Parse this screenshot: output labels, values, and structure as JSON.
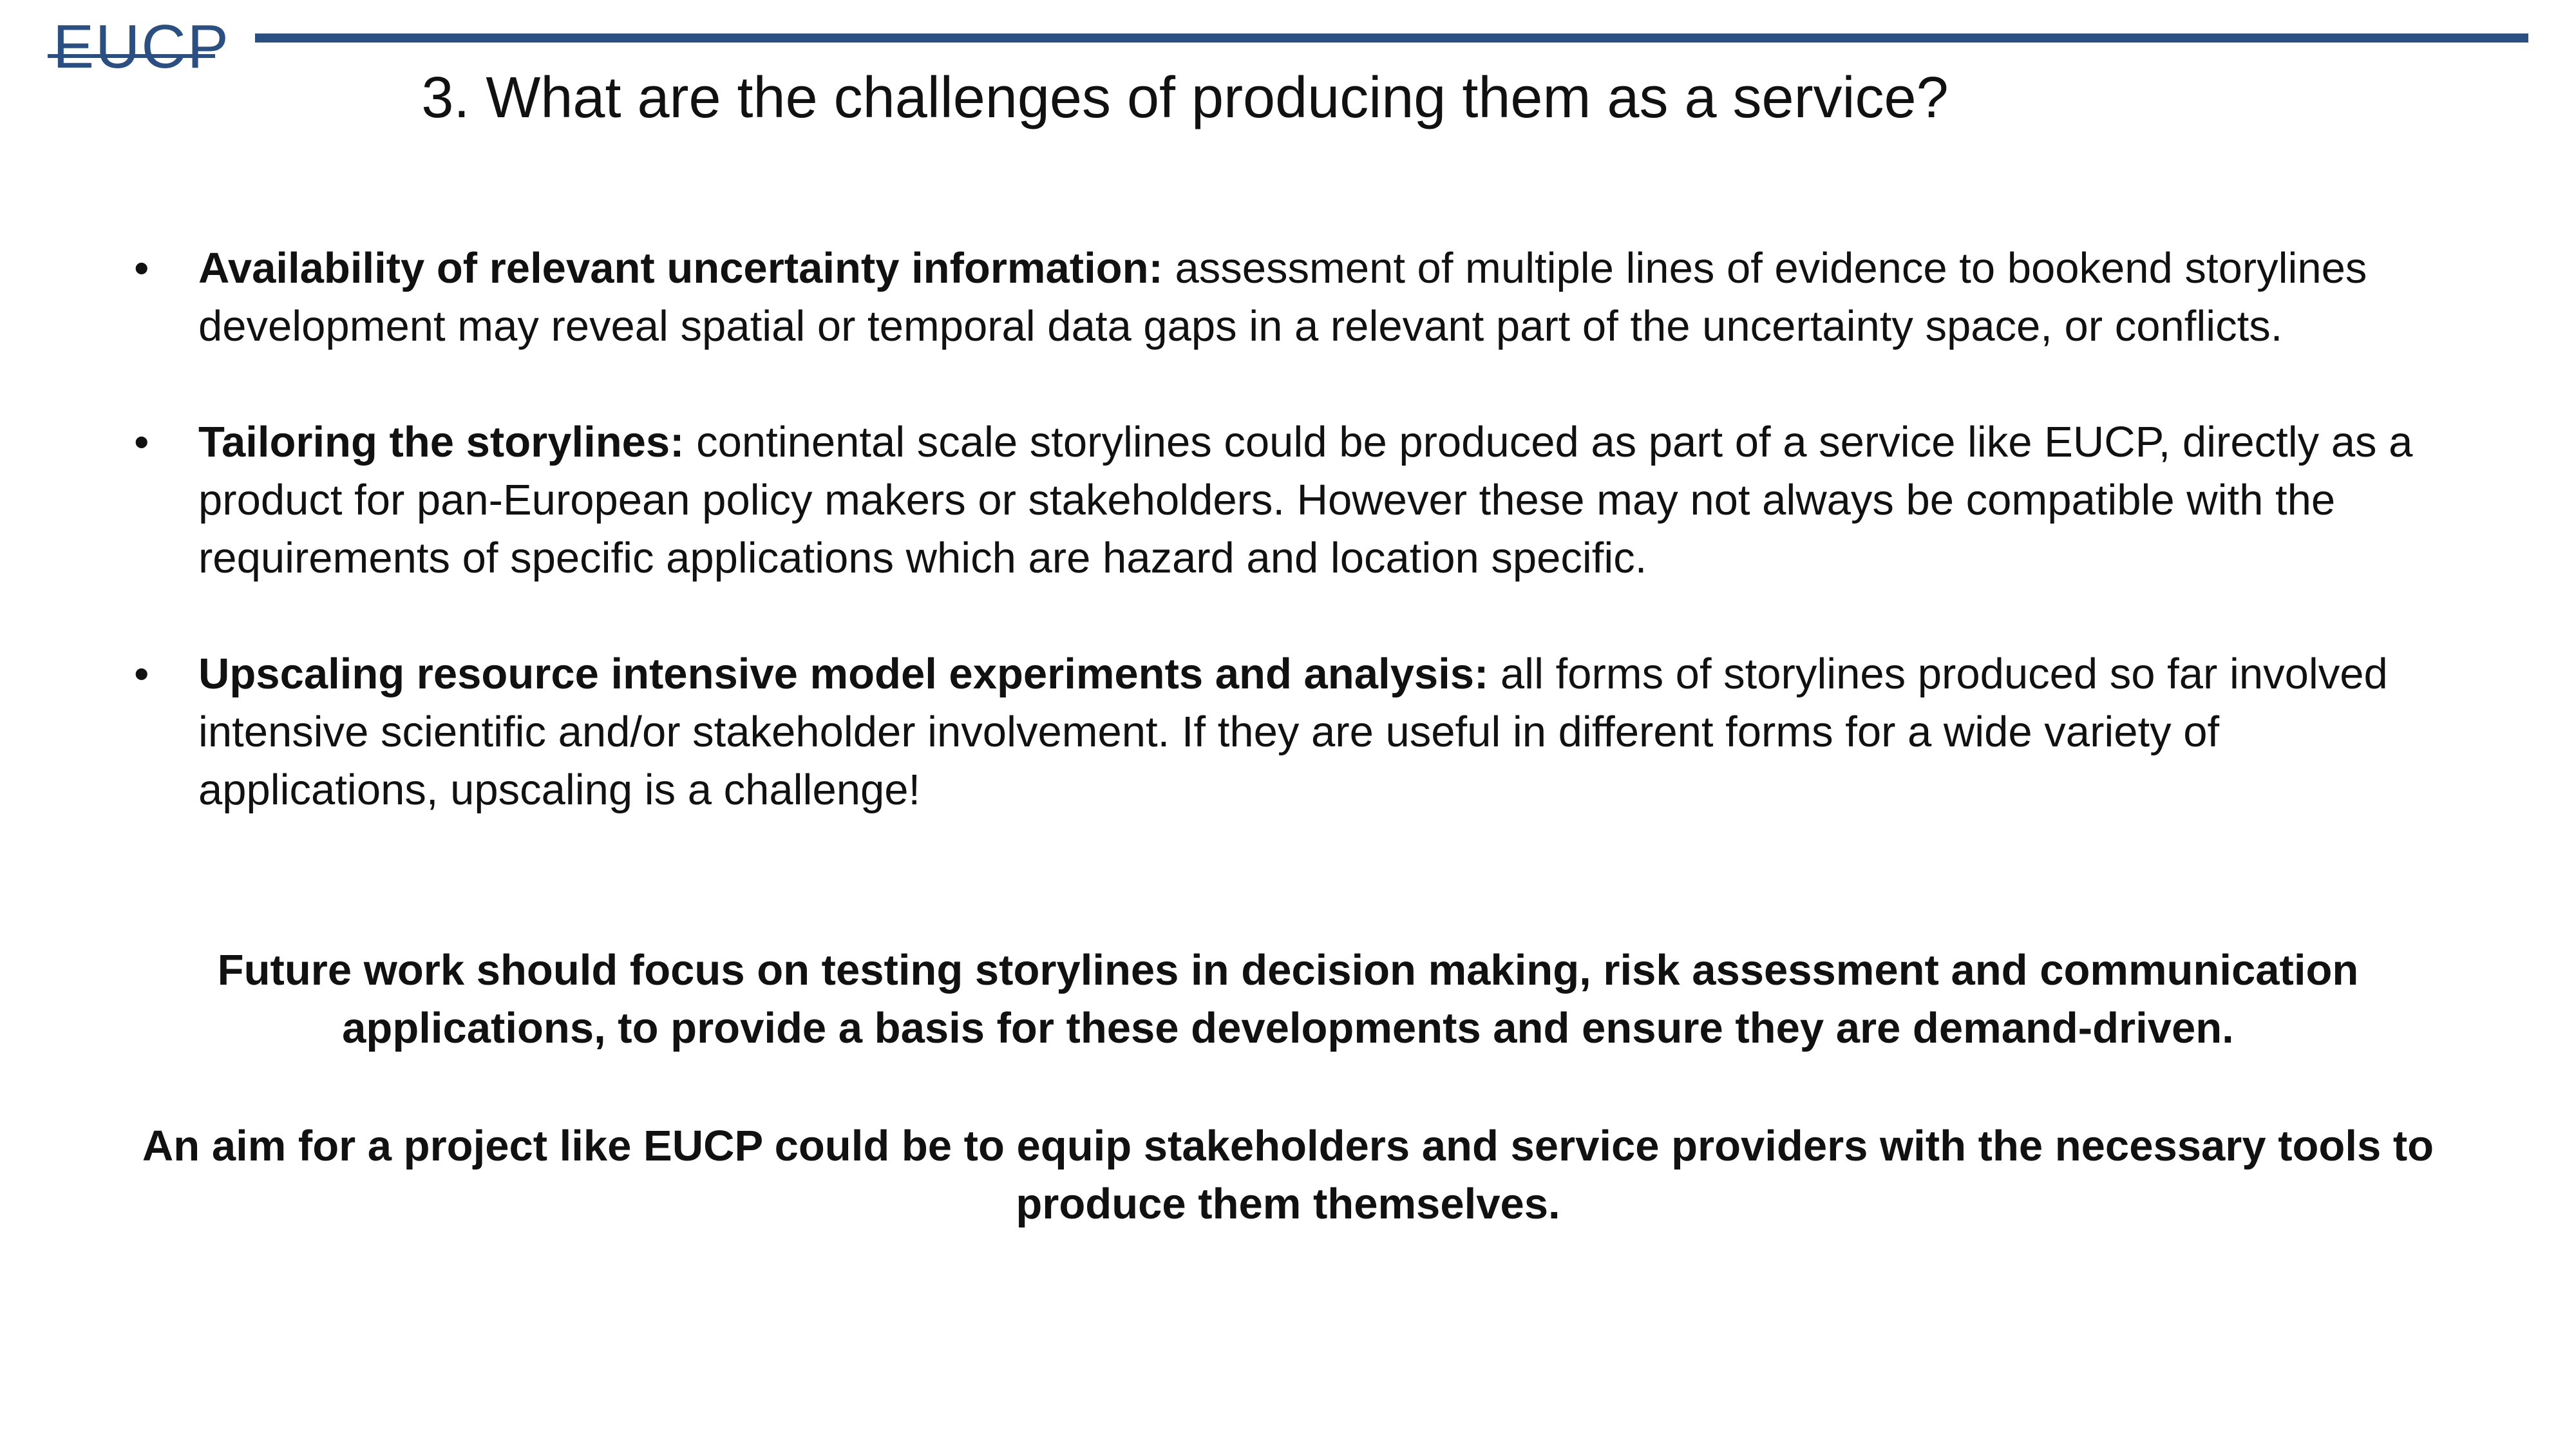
{
  "header": {
    "logo_text": "EUCP",
    "title": "3. What are the challenges of producing them as a service?",
    "brand_color": "#2a4f82"
  },
  "bullets": [
    {
      "marker": "•",
      "title": "Availability of relevant uncertainty information:",
      "text": "assessment of multiple lines of evidence to bookend storylines development may reveal spatial or temporal data gaps in a relevant part of the uncertainty space, or conflicts."
    },
    {
      "marker": "•",
      "title": "Tailoring the storylines:",
      "text": "continental scale storylines could be produced as part of a service like EUCP, directly as a product for pan-European policy makers or stakeholders. However these may not always be compatible with the requirements of specific applications which are hazard and location specific."
    },
    {
      "marker": "•",
      "title": "Upscaling resource intensive model experiments and analysis:",
      "text": "all forms of storylines produced so far involved intensive scientific and/or stakeholder involvement. If they are useful in different forms for a wide variety of applications, upscaling is a challenge!"
    }
  ],
  "conclusions": [
    "Future work should focus on testing storylines in decision making, risk assessment and communication applications, to provide a basis for these developments and ensure they are demand-driven.",
    "An aim for a project like EUCP could be to equip stakeholders and service providers with the necessary tools to produce them themselves."
  ]
}
